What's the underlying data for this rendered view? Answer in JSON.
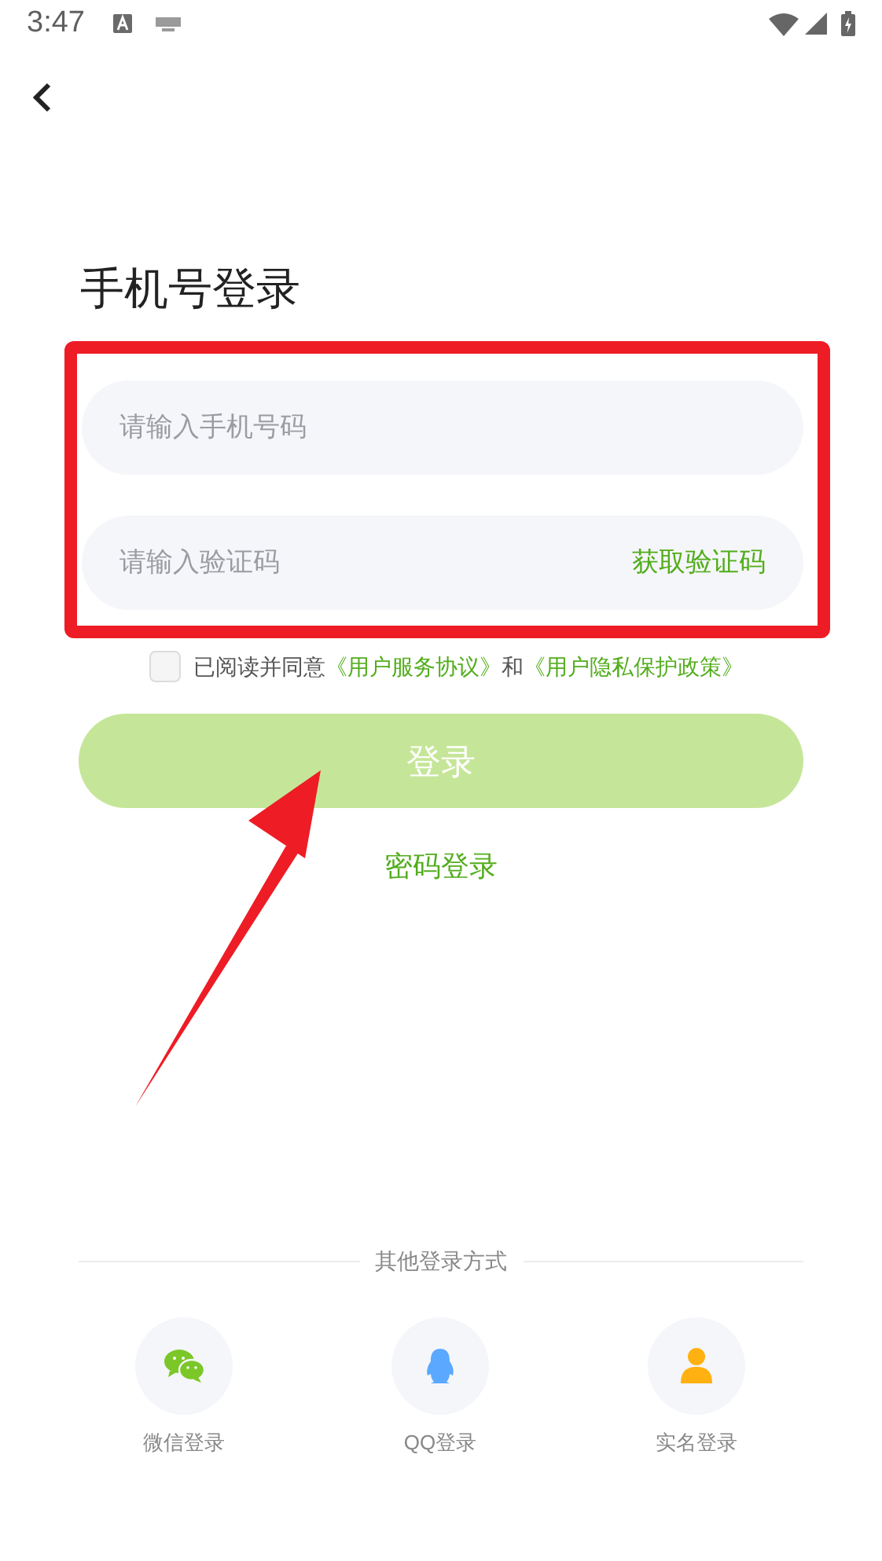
{
  "status_bar": {
    "time": "3:47"
  },
  "title": "手机号登录",
  "phone_field": {
    "placeholder": "请输入手机号码"
  },
  "code_field": {
    "placeholder": "请输入验证码",
    "action": "获取验证码"
  },
  "agreement": {
    "checked": false,
    "prefix": "已阅读并同意",
    "link_1": "《用户服务协议》",
    "joiner": "和",
    "link_2": "《用户隐私保护政策》"
  },
  "login_button": "登录",
  "password_login": "密码登录",
  "other_methods": {
    "heading": "其他登录方式",
    "items": [
      {
        "kind": "wechat",
        "label": "微信登录"
      },
      {
        "kind": "qq",
        "label": "QQ登录"
      },
      {
        "kind": "realname",
        "label": "实名登录"
      }
    ]
  }
}
